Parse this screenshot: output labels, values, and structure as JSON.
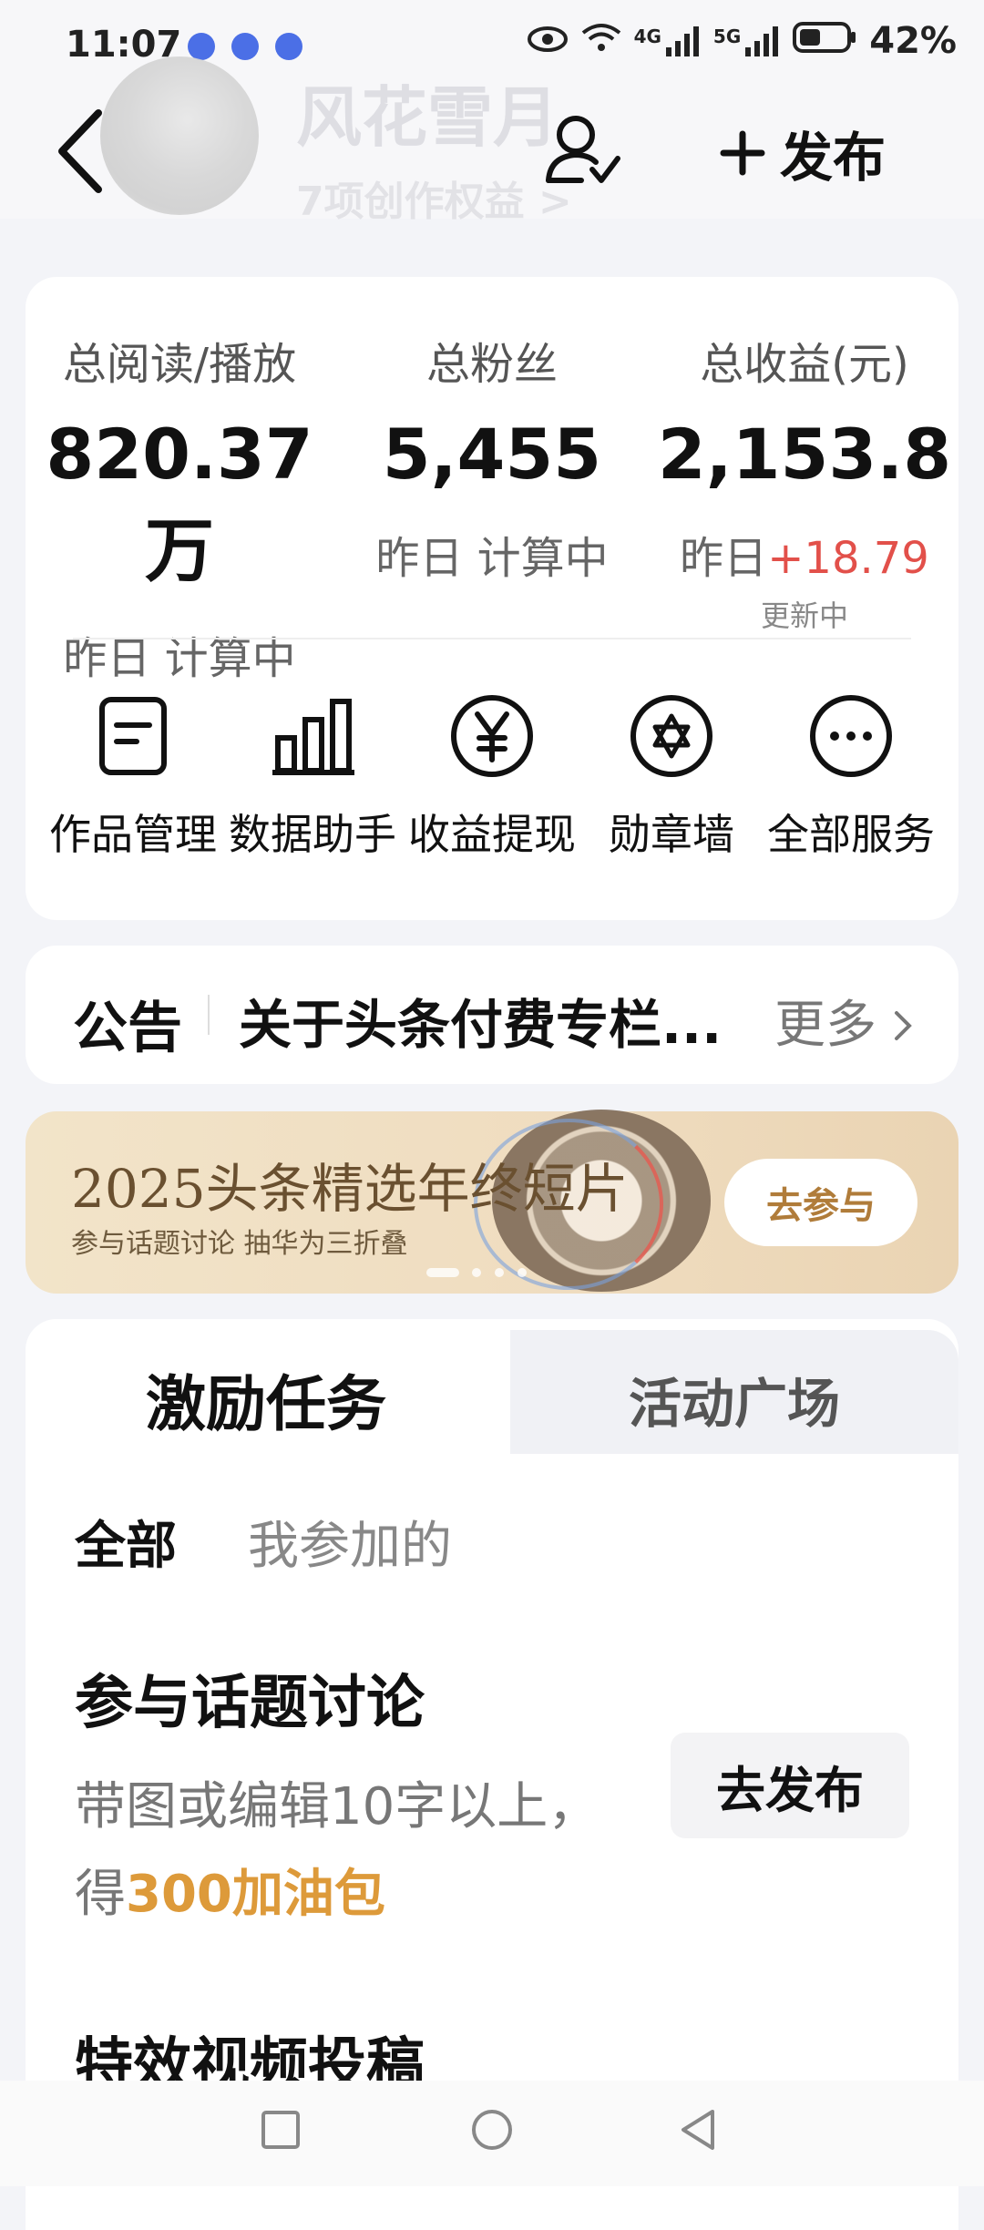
{
  "status_bar": {
    "time": "11:07",
    "signal_4g": "4G",
    "signal_5g": "5G",
    "battery": "42%"
  },
  "header": {
    "name": "风花雪月",
    "subtitle": "7项创作权益 >",
    "publish_label": "发布"
  },
  "stats": [
    {
      "label": "总阅读/播放",
      "value": "820.37万",
      "yesterday_prefix": "昨日",
      "yesterday_value": " 计算中"
    },
    {
      "label": "总粉丝",
      "value": "5,455",
      "yesterday_prefix": "昨日",
      "yesterday_value": " 计算中"
    },
    {
      "label": "总收益(元)",
      "value": "2,153.8",
      "yesterday_prefix": "昨日",
      "yesterday_value": "+18.79",
      "note": "更新中"
    }
  ],
  "services": [
    {
      "icon": "document-icon",
      "label": "作品管理"
    },
    {
      "icon": "bar-chart-icon",
      "label": "数据助手"
    },
    {
      "icon": "yuan-icon",
      "label": "收益提现"
    },
    {
      "icon": "badge-icon",
      "label": "勋章墙"
    },
    {
      "icon": "more-icon",
      "label": "全部服务"
    }
  ],
  "notice": {
    "title": "公告",
    "text": "关于头条付费专栏...",
    "more": "更多"
  },
  "banner": {
    "title": "2025头条精选年终短片",
    "subtitle": "参与话题讨论 抽华为三折叠",
    "button": "去参与",
    "page_count": 4,
    "active_page": 1
  },
  "tasks": {
    "tabs": [
      "激励任务",
      "活动广场"
    ],
    "filters": [
      "全部",
      "我参加的"
    ],
    "items": [
      {
        "title": "参与话题讨论",
        "desc_line1": "带图或编辑10字以上，",
        "desc_prefix": "得",
        "desc_reward": "300加油包",
        "button": "去发布"
      },
      {
        "title": "特效视频投稿"
      }
    ]
  },
  "colors": {
    "accent_red": "#e2504a",
    "reward_orange": "#dd9a3a",
    "banner_gold": "#b07c3a"
  }
}
